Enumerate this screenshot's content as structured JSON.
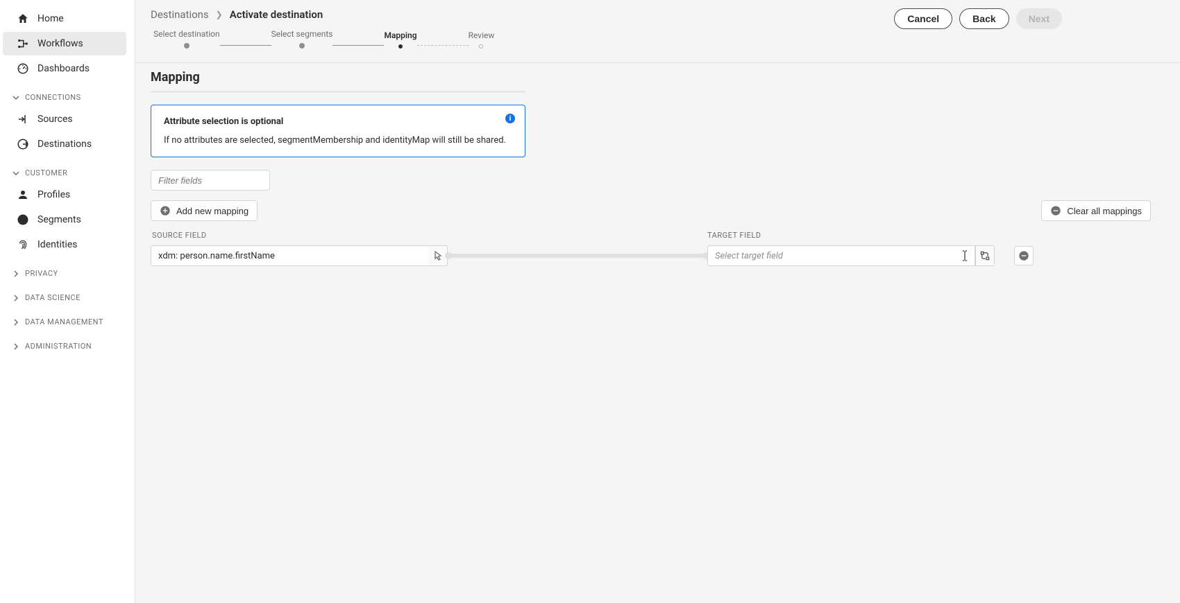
{
  "sidebar": {
    "top": [
      {
        "label": "Home",
        "id": "home"
      },
      {
        "label": "Workflows",
        "id": "workflows",
        "active": true
      },
      {
        "label": "Dashboards",
        "id": "dashboards"
      }
    ],
    "groups": [
      {
        "label": "CONNECTIONS",
        "expanded": true,
        "items": [
          {
            "label": "Sources",
            "id": "sources"
          },
          {
            "label": "Destinations",
            "id": "destinations"
          }
        ]
      },
      {
        "label": "CUSTOMER",
        "expanded": true,
        "items": [
          {
            "label": "Profiles",
            "id": "profiles"
          },
          {
            "label": "Segments",
            "id": "segments"
          },
          {
            "label": "Identities",
            "id": "identities"
          }
        ]
      },
      {
        "label": "PRIVACY",
        "expanded": false,
        "items": []
      },
      {
        "label": "DATA SCIENCE",
        "expanded": false,
        "items": []
      },
      {
        "label": "DATA MANAGEMENT",
        "expanded": false,
        "items": []
      },
      {
        "label": "ADMINISTRATION",
        "expanded": false,
        "items": []
      }
    ]
  },
  "breadcrumb": {
    "root": "Destinations",
    "current": "Activate destination"
  },
  "actions": {
    "cancel": "Cancel",
    "back": "Back",
    "next": "Next"
  },
  "stepper": [
    {
      "label": "Select destination",
      "state": "done"
    },
    {
      "label": "Select segments",
      "state": "done"
    },
    {
      "label": "Mapping",
      "state": "active"
    },
    {
      "label": "Review",
      "state": "future"
    }
  ],
  "section": {
    "title": "Mapping"
  },
  "infoBox": {
    "title": "Attribute selection is optional",
    "body": "If no attributes are selected, segmentMembership and identityMap will still be shared."
  },
  "filter": {
    "placeholder": "Filter fields"
  },
  "toolbar": {
    "addMapping": "Add new mapping",
    "clearAll": "Clear all mappings"
  },
  "columns": {
    "source": "SOURCE FIELD",
    "target": "TARGET FIELD"
  },
  "mappings": [
    {
      "source": "xdm: person.name.firstName",
      "targetPlaceholder": "Select target field"
    }
  ]
}
